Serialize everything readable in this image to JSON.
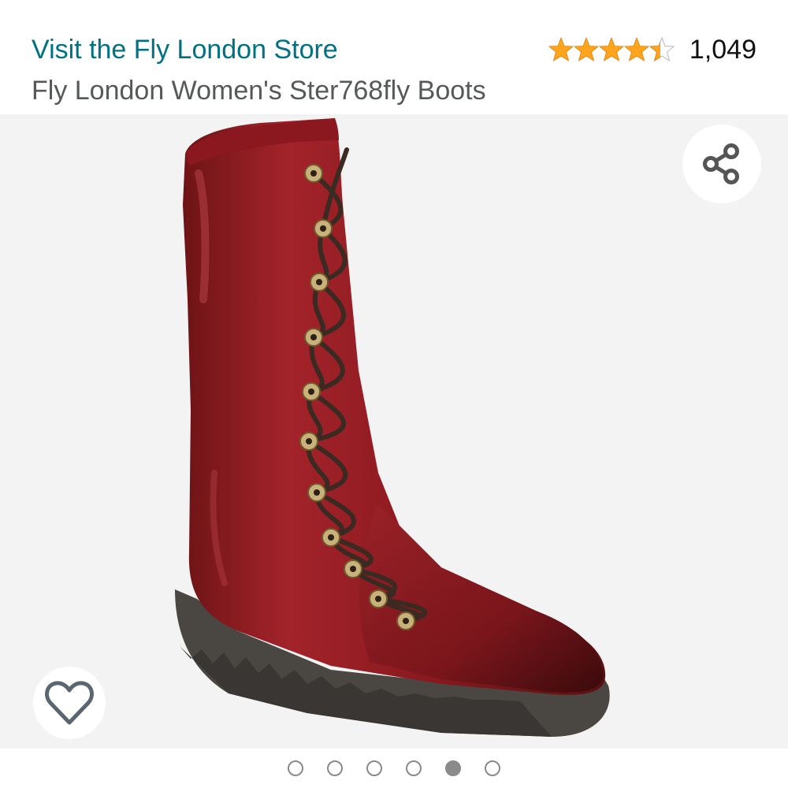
{
  "header": {
    "store_link": "Visit the Fly London Store",
    "product_title": "Fly London Women's Ster768fly Boots",
    "rating": {
      "stars": 4.5,
      "count": "1,049"
    }
  },
  "gallery": {
    "image_alt": "Red leather lace-up mid-calf boot",
    "total_images": 6,
    "active_index": 4,
    "share_icon": "share-icon",
    "wishlist_icon": "heart-outline-icon"
  },
  "colors": {
    "link": "#007185",
    "title": "#565959",
    "star": "#FFA41C",
    "image_bg": "#f3f3f3",
    "dot": "#8a8a8a"
  }
}
